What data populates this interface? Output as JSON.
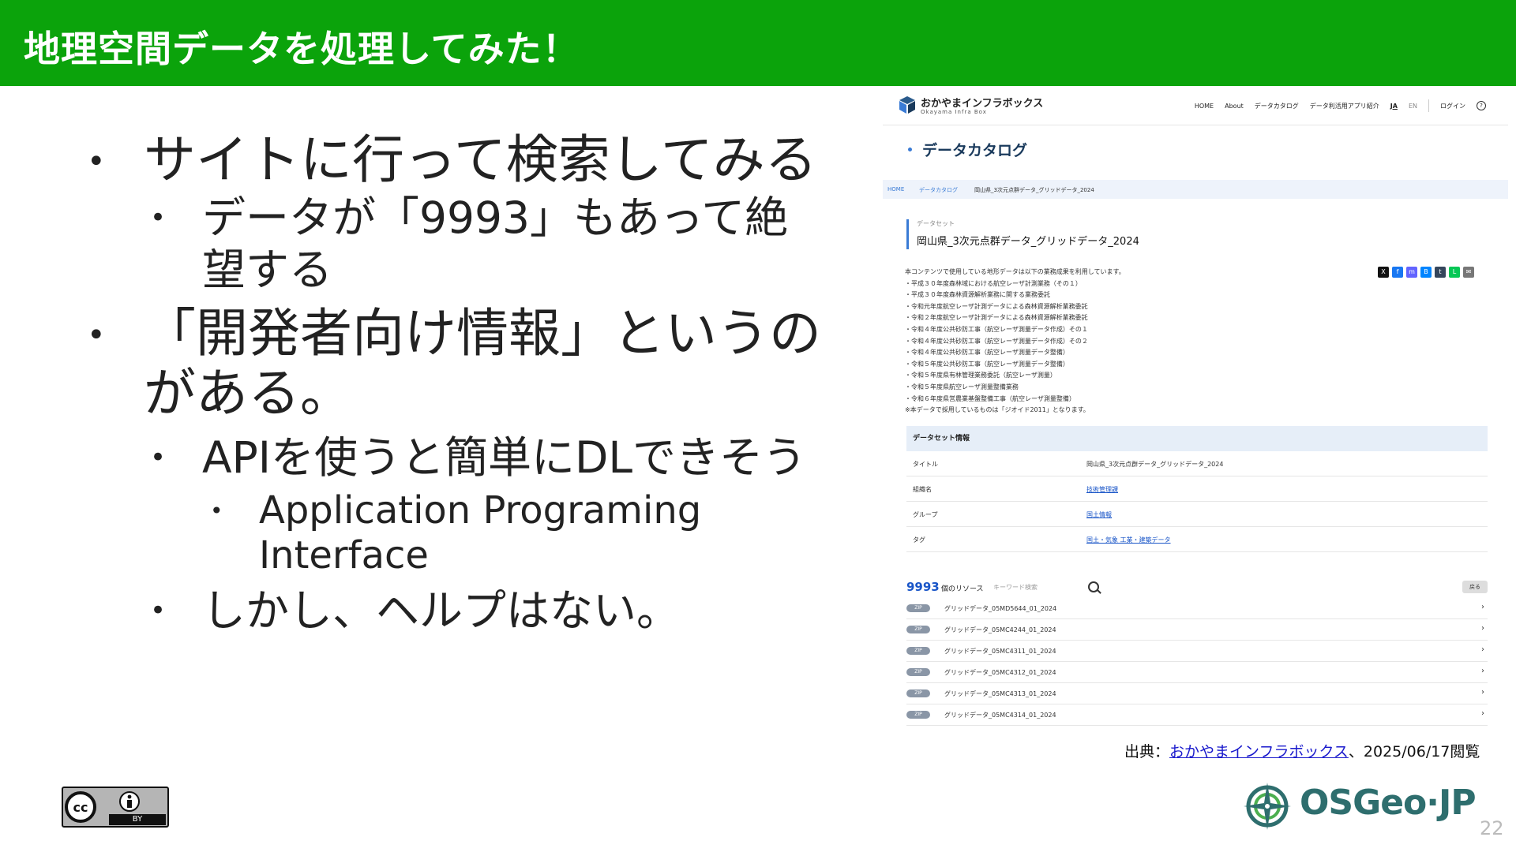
{
  "slide": {
    "title": "地理空間データを処理してみた！",
    "page_number": "22"
  },
  "bullets": [
    {
      "level": 1,
      "text": "サイトに行って検索してみる"
    },
    {
      "level": 2,
      "text": "データが「9993」もあって絶望する"
    },
    {
      "level": 1,
      "text": "「開発者向け情報」というのがある。"
    },
    {
      "level": 2,
      "text": "APIを使うと簡単にDLできそう"
    },
    {
      "level": 3,
      "text": "Application Programing Interface"
    },
    {
      "level": 2,
      "text": "しかし、ヘルプはない。"
    }
  ],
  "screenshot": {
    "site_name": "おかやまインフラボックス",
    "site_sub": "Okayama Infra Box",
    "nav": [
      "HOME",
      "About",
      "データカタログ",
      "データ利活用アプリ紹介",
      "JA",
      "EN",
      "ログイン"
    ],
    "page_heading": "データカタログ",
    "breadcrumb": [
      "HOME",
      "データカタログ",
      "岡山県_3次元点群データ_グリッドデータ_2024"
    ],
    "dataset_label": "データセット",
    "dataset_title": "岡山県_3次元点群データ_グリッドデータ_2024",
    "description": [
      "本コンテンツで使用している地形データは以下の業務成果を利用しています。",
      "・平成３０年度森林域における航空レーザ計測業務（その１）",
      "・平成３０年度森林資源解析業務に関する業務委託",
      "・令和元年度航空レーザ計測データによる森林資源解析業務委託",
      "・令和２年度航空レーザ計測データによる森林資源解析業務委託",
      "・令和４年度公共砂防工事（航空レーザ測量データ作成）その１",
      "・令和４年度公共砂防工事（航空レーザ測量データ作成）その２",
      "・令和４年度公共砂防工事（航空レーザ測量データ整備）",
      "・令和５年度公共砂防工事（航空レーザ測量データ整備）",
      "・令和５年度県有林管理業務委託（航空レーザ測量）",
      "・令和５年度県航空レーザ測量整備業務",
      "・令和６年度県営農業基盤整備工事（航空レーザ測量整備）",
      "※本データで採用しているものは「ジオイド2011」となります。"
    ],
    "share_icons": [
      "X",
      "f",
      "m",
      "B",
      "t",
      "L",
      "✉"
    ],
    "info": {
      "heading": "データセット情報",
      "rows": [
        {
          "key": "タイトル",
          "value": "岡山県_3次元点群データ_グリッドデータ_2024",
          "link": false
        },
        {
          "key": "組織名",
          "value": "技術管理課",
          "link": true
        },
        {
          "key": "グループ",
          "value": "国土情報",
          "link": true
        },
        {
          "key": "タグ",
          "value": "国土・気象  工業・建築データ",
          "link": true
        }
      ]
    },
    "resources": {
      "count": "9993",
      "count_label": "個のリソース",
      "search_placeholder": "キーワード検索",
      "close_label": "戻る",
      "items": [
        {
          "format": "ZIP",
          "name": "グリッドデータ_05MD5644_01_2024"
        },
        {
          "format": "ZIP",
          "name": "グリッドデータ_05MC4244_01_2024"
        },
        {
          "format": "ZIP",
          "name": "グリッドデータ_05MC4311_01_2024"
        },
        {
          "format": "ZIP",
          "name": "グリッドデータ_05MC4312_01_2024"
        },
        {
          "format": "ZIP",
          "name": "グリッドデータ_05MC4313_01_2024"
        },
        {
          "format": "ZIP",
          "name": "グリッドデータ_05MC4314_01_2024"
        }
      ]
    }
  },
  "source": {
    "prefix": "出典：",
    "link_text": "おかやまインフラボックス",
    "suffix": "、2025/06/17閲覧"
  },
  "license": {
    "badge": "cc",
    "by": "BY"
  },
  "logo": {
    "text": "OSGeo·JP"
  },
  "colors": {
    "header_green": "#0ba30b",
    "link_blue": "#1a1acc",
    "osgeo_teal": "#2e6e6e"
  }
}
